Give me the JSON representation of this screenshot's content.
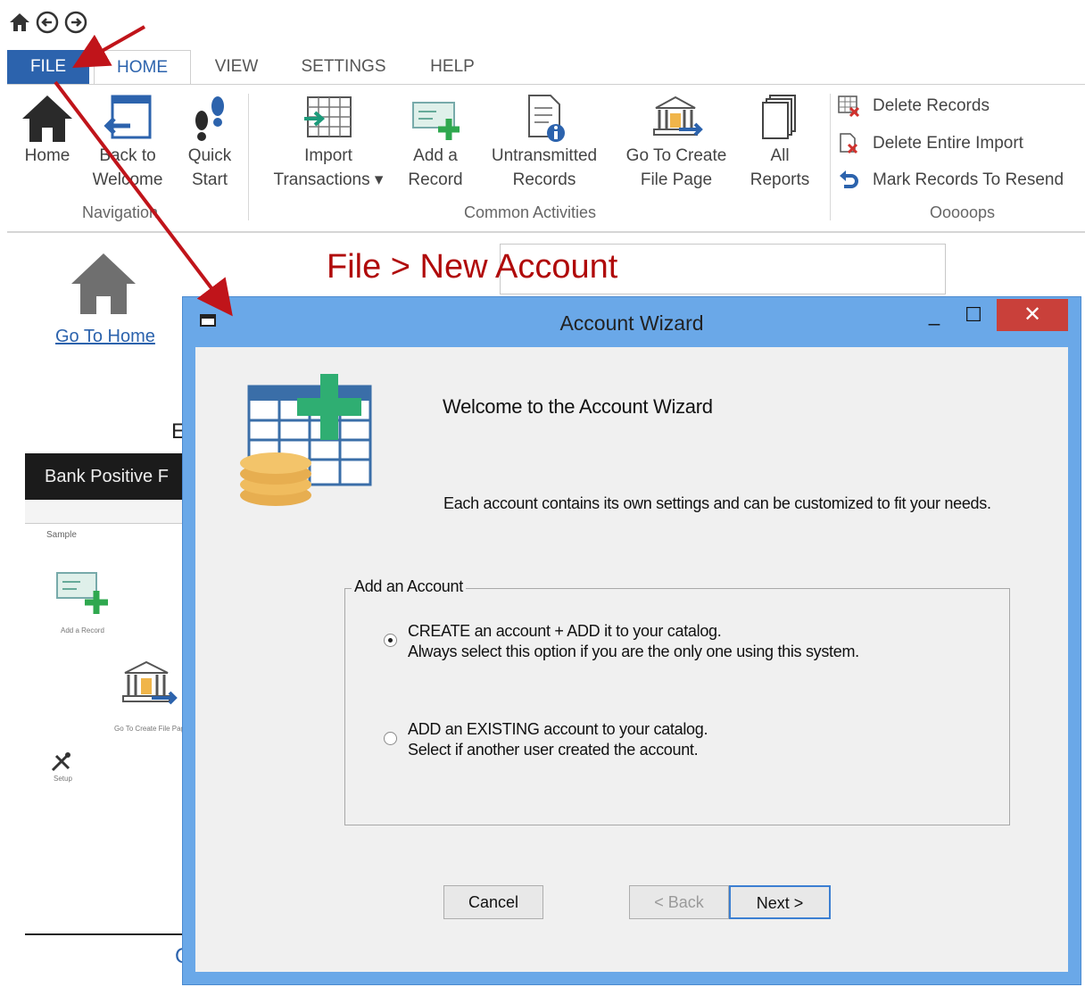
{
  "quick_access": {
    "icons": [
      "home-icon",
      "back-circle-icon",
      "forward-circle-icon"
    ]
  },
  "tabs": {
    "file": "FILE",
    "home": "HOME",
    "view": "VIEW",
    "settings": "SETTINGS",
    "help": "HELP"
  },
  "ribbon": {
    "navigation": {
      "label": "Navigation",
      "home": "Home",
      "back_to_welcome_1": "Back to",
      "back_to_welcome_2": "Welcome",
      "quick_start_1": "Quick",
      "quick_start_2": "Start"
    },
    "common": {
      "label": "Common Activities",
      "import_1": "Import",
      "import_2": "Transactions ▾",
      "add_1": "Add a",
      "add_2": "Record",
      "untrans_1": "Untransmitted",
      "untrans_2": "Records",
      "goto_1": "Go To Create",
      "goto_2": "File Page",
      "all_1": "All",
      "all_2": "Reports"
    },
    "oops": {
      "label": "Ooooops",
      "delete_records": "Delete Records",
      "delete_import": "Delete Entire Import",
      "mark_resend": "Mark Records To Resend"
    }
  },
  "background": {
    "go_to_home": "Go To Home",
    "bank_title": "Bank Positive F",
    "sample": "Sample",
    "partial_letter": "E",
    "add_record_small": "Add a Record",
    "goto_small": "Go To Create File Page",
    "setup_small": "Setup"
  },
  "annotation": {
    "text": "File > New Account",
    "color": "#b00a0a"
  },
  "dialog": {
    "title": "Account Wizard",
    "welcome": "Welcome to the Account Wizard",
    "description": "Each account contains its own settings and can be customized to fit your needs.",
    "group_title": "Add an Account",
    "option1_line1": "CREATE  an account + ADD it to your catalog.",
    "option1_line2": "Always select this option if you are the only one using this system.",
    "option2_line1": "ADD an EXISTING account to your catalog.",
    "option2_line2": "Select if another user created the account.",
    "selected_option": 1,
    "cancel": "Cancel",
    "back": "< Back",
    "next": "Next >",
    "minimize": "_",
    "maximize": "☐",
    "close": "✕"
  },
  "colors": {
    "accent": "#2c63ad",
    "dialog_frame": "#6aa8e8",
    "close": "#c9403a",
    "arrow": "#c0141a"
  }
}
